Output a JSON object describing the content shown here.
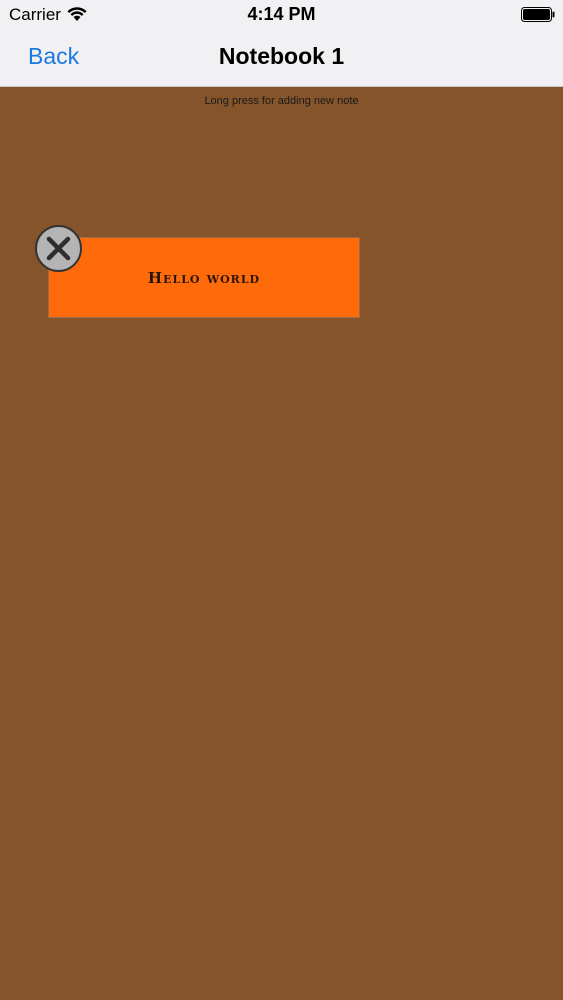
{
  "status_bar": {
    "carrier": "Carrier",
    "time": "4:14 PM",
    "wifi_icon": "wifi-icon",
    "battery_icon": "battery-icon"
  },
  "nav": {
    "back_label": "Back",
    "title": "Notebook 1"
  },
  "canvas": {
    "hint": "Long press for adding new note",
    "background_color": "#85542a"
  },
  "notes": [
    {
      "text": "Hello world",
      "color": "#ff6a0a",
      "delete_icon": "close-icon"
    }
  ],
  "colors": {
    "accent": "#1b78e0",
    "nav_background": "#f1f1f3"
  }
}
